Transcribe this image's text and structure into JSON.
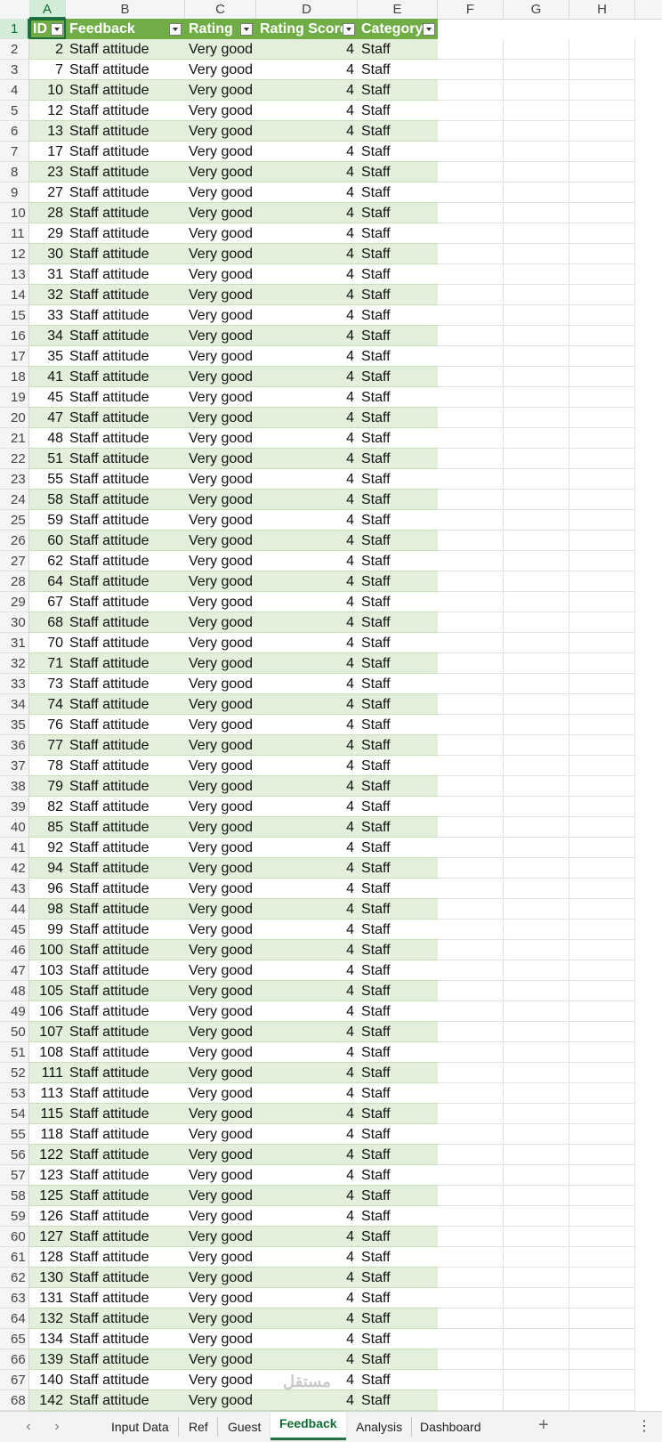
{
  "sheet": {
    "columns": [
      "A",
      "B",
      "C",
      "D",
      "E",
      "F",
      "G",
      "H"
    ],
    "selected_column": "A",
    "table_headers": [
      "ID",
      "Feedback",
      "Rating",
      "Rating Score",
      "Category"
    ],
    "rows": [
      {
        "n": "2",
        "id": "2",
        "fb": "Staff attitude",
        "rating": "Very good",
        "score": "4",
        "cat": "Staff"
      },
      {
        "n": "3",
        "id": "7",
        "fb": "Staff attitude",
        "rating": "Very good",
        "score": "4",
        "cat": "Staff"
      },
      {
        "n": "4",
        "id": "10",
        "fb": "Staff attitude",
        "rating": "Very good",
        "score": "4",
        "cat": "Staff"
      },
      {
        "n": "5",
        "id": "12",
        "fb": "Staff attitude",
        "rating": "Very good",
        "score": "4",
        "cat": "Staff"
      },
      {
        "n": "6",
        "id": "13",
        "fb": "Staff attitude",
        "rating": "Very good",
        "score": "4",
        "cat": "Staff"
      },
      {
        "n": "7",
        "id": "17",
        "fb": "Staff attitude",
        "rating": "Very good",
        "score": "4",
        "cat": "Staff"
      },
      {
        "n": "8",
        "id": "23",
        "fb": "Staff attitude",
        "rating": "Very good",
        "score": "4",
        "cat": "Staff"
      },
      {
        "n": "9",
        "id": "27",
        "fb": "Staff attitude",
        "rating": "Very good",
        "score": "4",
        "cat": "Staff"
      },
      {
        "n": "10",
        "id": "28",
        "fb": "Staff attitude",
        "rating": "Very good",
        "score": "4",
        "cat": "Staff"
      },
      {
        "n": "11",
        "id": "29",
        "fb": "Staff attitude",
        "rating": "Very good",
        "score": "4",
        "cat": "Staff"
      },
      {
        "n": "12",
        "id": "30",
        "fb": "Staff attitude",
        "rating": "Very good",
        "score": "4",
        "cat": "Staff"
      },
      {
        "n": "13",
        "id": "31",
        "fb": "Staff attitude",
        "rating": "Very good",
        "score": "4",
        "cat": "Staff"
      },
      {
        "n": "14",
        "id": "32",
        "fb": "Staff attitude",
        "rating": "Very good",
        "score": "4",
        "cat": "Staff"
      },
      {
        "n": "15",
        "id": "33",
        "fb": "Staff attitude",
        "rating": "Very good",
        "score": "4",
        "cat": "Staff"
      },
      {
        "n": "16",
        "id": "34",
        "fb": "Staff attitude",
        "rating": "Very good",
        "score": "4",
        "cat": "Staff"
      },
      {
        "n": "17",
        "id": "35",
        "fb": "Staff attitude",
        "rating": "Very good",
        "score": "4",
        "cat": "Staff"
      },
      {
        "n": "18",
        "id": "41",
        "fb": "Staff attitude",
        "rating": "Very good",
        "score": "4",
        "cat": "Staff"
      },
      {
        "n": "19",
        "id": "45",
        "fb": "Staff attitude",
        "rating": "Very good",
        "score": "4",
        "cat": "Staff"
      },
      {
        "n": "20",
        "id": "47",
        "fb": "Staff attitude",
        "rating": "Very good",
        "score": "4",
        "cat": "Staff"
      },
      {
        "n": "21",
        "id": "48",
        "fb": "Staff attitude",
        "rating": "Very good",
        "score": "4",
        "cat": "Staff"
      },
      {
        "n": "22",
        "id": "51",
        "fb": "Staff attitude",
        "rating": "Very good",
        "score": "4",
        "cat": "Staff"
      },
      {
        "n": "23",
        "id": "55",
        "fb": "Staff attitude",
        "rating": "Very good",
        "score": "4",
        "cat": "Staff"
      },
      {
        "n": "24",
        "id": "58",
        "fb": "Staff attitude",
        "rating": "Very good",
        "score": "4",
        "cat": "Staff"
      },
      {
        "n": "25",
        "id": "59",
        "fb": "Staff attitude",
        "rating": "Very good",
        "score": "4",
        "cat": "Staff"
      },
      {
        "n": "26",
        "id": "60",
        "fb": "Staff attitude",
        "rating": "Very good",
        "score": "4",
        "cat": "Staff"
      },
      {
        "n": "27",
        "id": "62",
        "fb": "Staff attitude",
        "rating": "Very good",
        "score": "4",
        "cat": "Staff"
      },
      {
        "n": "28",
        "id": "64",
        "fb": "Staff attitude",
        "rating": "Very good",
        "score": "4",
        "cat": "Staff"
      },
      {
        "n": "29",
        "id": "67",
        "fb": "Staff attitude",
        "rating": "Very good",
        "score": "4",
        "cat": "Staff"
      },
      {
        "n": "30",
        "id": "68",
        "fb": "Staff attitude",
        "rating": "Very good",
        "score": "4",
        "cat": "Staff"
      },
      {
        "n": "31",
        "id": "70",
        "fb": "Staff attitude",
        "rating": "Very good",
        "score": "4",
        "cat": "Staff"
      },
      {
        "n": "32",
        "id": "71",
        "fb": "Staff attitude",
        "rating": "Very good",
        "score": "4",
        "cat": "Staff"
      },
      {
        "n": "33",
        "id": "73",
        "fb": "Staff attitude",
        "rating": "Very good",
        "score": "4",
        "cat": "Staff"
      },
      {
        "n": "34",
        "id": "74",
        "fb": "Staff attitude",
        "rating": "Very good",
        "score": "4",
        "cat": "Staff"
      },
      {
        "n": "35",
        "id": "76",
        "fb": "Staff attitude",
        "rating": "Very good",
        "score": "4",
        "cat": "Staff"
      },
      {
        "n": "36",
        "id": "77",
        "fb": "Staff attitude",
        "rating": "Very good",
        "score": "4",
        "cat": "Staff"
      },
      {
        "n": "37",
        "id": "78",
        "fb": "Staff attitude",
        "rating": "Very good",
        "score": "4",
        "cat": "Staff"
      },
      {
        "n": "38",
        "id": "79",
        "fb": "Staff attitude",
        "rating": "Very good",
        "score": "4",
        "cat": "Staff"
      },
      {
        "n": "39",
        "id": "82",
        "fb": "Staff attitude",
        "rating": "Very good",
        "score": "4",
        "cat": "Staff"
      },
      {
        "n": "40",
        "id": "85",
        "fb": "Staff attitude",
        "rating": "Very good",
        "score": "4",
        "cat": "Staff"
      },
      {
        "n": "41",
        "id": "92",
        "fb": "Staff attitude",
        "rating": "Very good",
        "score": "4",
        "cat": "Staff"
      },
      {
        "n": "42",
        "id": "94",
        "fb": "Staff attitude",
        "rating": "Very good",
        "score": "4",
        "cat": "Staff"
      },
      {
        "n": "43",
        "id": "96",
        "fb": "Staff attitude",
        "rating": "Very good",
        "score": "4",
        "cat": "Staff"
      },
      {
        "n": "44",
        "id": "98",
        "fb": "Staff attitude",
        "rating": "Very good",
        "score": "4",
        "cat": "Staff"
      },
      {
        "n": "45",
        "id": "99",
        "fb": "Staff attitude",
        "rating": "Very good",
        "score": "4",
        "cat": "Staff"
      },
      {
        "n": "46",
        "id": "100",
        "fb": "Staff attitude",
        "rating": "Very good",
        "score": "4",
        "cat": "Staff"
      },
      {
        "n": "47",
        "id": "103",
        "fb": "Staff attitude",
        "rating": "Very good",
        "score": "4",
        "cat": "Staff"
      },
      {
        "n": "48",
        "id": "105",
        "fb": "Staff attitude",
        "rating": "Very good",
        "score": "4",
        "cat": "Staff"
      },
      {
        "n": "49",
        "id": "106",
        "fb": "Staff attitude",
        "rating": "Very good",
        "score": "4",
        "cat": "Staff"
      },
      {
        "n": "50",
        "id": "107",
        "fb": "Staff attitude",
        "rating": "Very good",
        "score": "4",
        "cat": "Staff"
      },
      {
        "n": "51",
        "id": "108",
        "fb": "Staff attitude",
        "rating": "Very good",
        "score": "4",
        "cat": "Staff"
      },
      {
        "n": "52",
        "id": "111",
        "fb": "Staff attitude",
        "rating": "Very good",
        "score": "4",
        "cat": "Staff"
      },
      {
        "n": "53",
        "id": "113",
        "fb": "Staff attitude",
        "rating": "Very good",
        "score": "4",
        "cat": "Staff"
      },
      {
        "n": "54",
        "id": "115",
        "fb": "Staff attitude",
        "rating": "Very good",
        "score": "4",
        "cat": "Staff"
      },
      {
        "n": "55",
        "id": "118",
        "fb": "Staff attitude",
        "rating": "Very good",
        "score": "4",
        "cat": "Staff"
      },
      {
        "n": "56",
        "id": "122",
        "fb": "Staff attitude",
        "rating": "Very good",
        "score": "4",
        "cat": "Staff"
      },
      {
        "n": "57",
        "id": "123",
        "fb": "Staff attitude",
        "rating": "Very good",
        "score": "4",
        "cat": "Staff"
      },
      {
        "n": "58",
        "id": "125",
        "fb": "Staff attitude",
        "rating": "Very good",
        "score": "4",
        "cat": "Staff"
      },
      {
        "n": "59",
        "id": "126",
        "fb": "Staff attitude",
        "rating": "Very good",
        "score": "4",
        "cat": "Staff"
      },
      {
        "n": "60",
        "id": "127",
        "fb": "Staff attitude",
        "rating": "Very good",
        "score": "4",
        "cat": "Staff"
      },
      {
        "n": "61",
        "id": "128",
        "fb": "Staff attitude",
        "rating": "Very good",
        "score": "4",
        "cat": "Staff"
      },
      {
        "n": "62",
        "id": "130",
        "fb": "Staff attitude",
        "rating": "Very good",
        "score": "4",
        "cat": "Staff"
      },
      {
        "n": "63",
        "id": "131",
        "fb": "Staff attitude",
        "rating": "Very good",
        "score": "4",
        "cat": "Staff"
      },
      {
        "n": "64",
        "id": "132",
        "fb": "Staff attitude",
        "rating": "Very good",
        "score": "4",
        "cat": "Staff"
      },
      {
        "n": "65",
        "id": "134",
        "fb": "Staff attitude",
        "rating": "Very good",
        "score": "4",
        "cat": "Staff"
      },
      {
        "n": "66",
        "id": "139",
        "fb": "Staff attitude",
        "rating": "Very good",
        "score": "4",
        "cat": "Staff"
      },
      {
        "n": "67",
        "id": "140",
        "fb": "Staff attitude",
        "rating": "Very good",
        "score": "4",
        "cat": "Staff"
      },
      {
        "n": "68",
        "id": "142",
        "fb": "Staff attitude",
        "rating": "Very good",
        "score": "4",
        "cat": "Staff"
      }
    ]
  },
  "tabs": {
    "items": [
      "Input Data",
      "Ref",
      "Guest",
      "Feedback",
      "Analysis",
      "Dashboard"
    ],
    "active": "Feedback",
    "add_icon": "plus-icon",
    "more_icon": "vertical-ellipsis-icon"
  },
  "watermark": "mostaql.com",
  "colors": {
    "header_green": "#70ad47",
    "band_green": "#e2efda",
    "accent": "#217346"
  }
}
